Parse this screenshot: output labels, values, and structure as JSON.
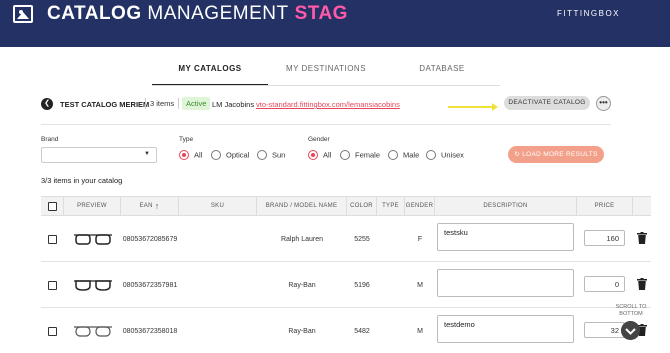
{
  "header": {
    "title_bold": "CATALOG",
    "title_rest": "MANAGEMENT",
    "env": "STAG",
    "brand": "FITTINGBOX"
  },
  "tabs": [
    {
      "label": "MY CATALOGS",
      "active": true
    },
    {
      "label": "MY DESTINATIONS",
      "active": false
    },
    {
      "label": "DATABASE",
      "active": false
    }
  ],
  "catalog": {
    "name": "TEST CATALOG MERIEM",
    "items": "3 items",
    "status": "Active",
    "owner": "LM Jacobins",
    "link": "vto-standard.fittingbox.com/lemansiacobins",
    "deactivate_label": "DEACTIVATE CATALOG",
    "more_label": "•••"
  },
  "filters": {
    "brand_label": "Brand",
    "brand_value": "",
    "type_label": "Type",
    "type_options": [
      "All",
      "Optical",
      "Sun"
    ],
    "type_selected": "All",
    "gender_label": "Gender",
    "gender_options": [
      "All",
      "Female",
      "Male",
      "Unisex"
    ],
    "gender_selected": "All",
    "load_more_label": "LOAD MORE RESULTS"
  },
  "count_text": "3/3 items in your catalog",
  "table": {
    "headers": [
      "PREVIEW",
      "EAN",
      "SKU",
      "BRAND / MODEL NAME",
      "COLOR",
      "TYPE",
      "GENDER",
      "DESCRIPTION",
      "PRICE"
    ],
    "rows": [
      {
        "ean": "08053672085679",
        "sku": "",
        "brand": "Ralph Lauren",
        "color": "5255",
        "type": "",
        "gender": "F",
        "description": "testsku",
        "price": "160"
      },
      {
        "ean": "08053672357981",
        "sku": "",
        "brand": "Ray-Ban",
        "color": "5196",
        "type": "",
        "gender": "M",
        "description": "",
        "price": "0"
      },
      {
        "ean": "08053672358018",
        "sku": "",
        "brand": "Ray-Ban",
        "color": "5482",
        "type": "",
        "gender": "M",
        "description": "testdemo",
        "price": "32"
      }
    ]
  },
  "scroll_label": "SCROLL TO BOTTOM",
  "colors": {
    "header_bg": "#243165",
    "accent": "#e5465a",
    "env": "#ff5aa8",
    "active_badge": "#3d8d2a"
  }
}
